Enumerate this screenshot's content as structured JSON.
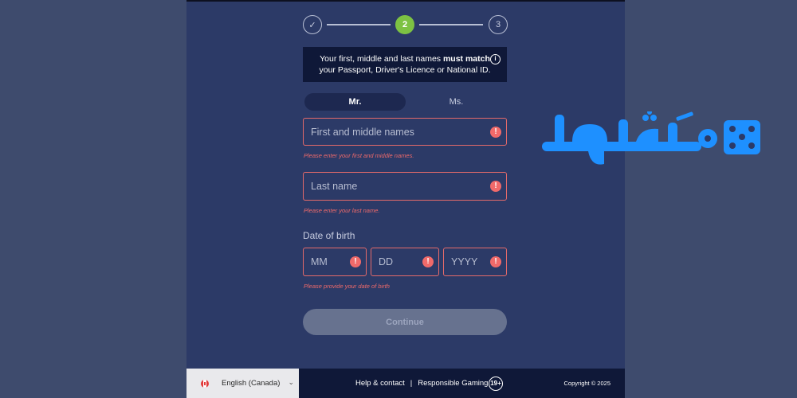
{
  "stepper": {
    "step1": "✓",
    "step2": "2",
    "step3": "3",
    "active_color": "#7dc243"
  },
  "info": {
    "line1_pre": "Your first, middle and last names ",
    "line1_bold": "must match",
    "line2": "your Passport, Driver's Licence or National ID.",
    "icon": "i"
  },
  "gender": {
    "options": [
      "Mr.",
      "Ms."
    ],
    "selected": "Mr."
  },
  "form": {
    "first_name": {
      "placeholder": "First and middle names",
      "error": "Please enter your first and middle names."
    },
    "last_name": {
      "placeholder": "Last name",
      "error": "Please enter your last name."
    },
    "dob": {
      "label": "Date of birth",
      "mm_placeholder": "MM",
      "dd_placeholder": "DD",
      "yyyy_placeholder": "YYYY",
      "error": "Please provide your date of birth"
    },
    "error_icon": "!",
    "error_color": "#f06a6a",
    "continue_label": "Continue"
  },
  "footer": {
    "language": "English (Canada)",
    "help": "Help & contact",
    "separator": "|",
    "responsible": "Responsible Gaming",
    "age_badge": "19+",
    "copyright": "Copyright © 2025"
  },
  "colors": {
    "page_bg": "#3e4b6d",
    "panel_bg": "#2c3a67",
    "dark_navy": "#0f1838",
    "logo_blue": "#1e90ff"
  }
}
